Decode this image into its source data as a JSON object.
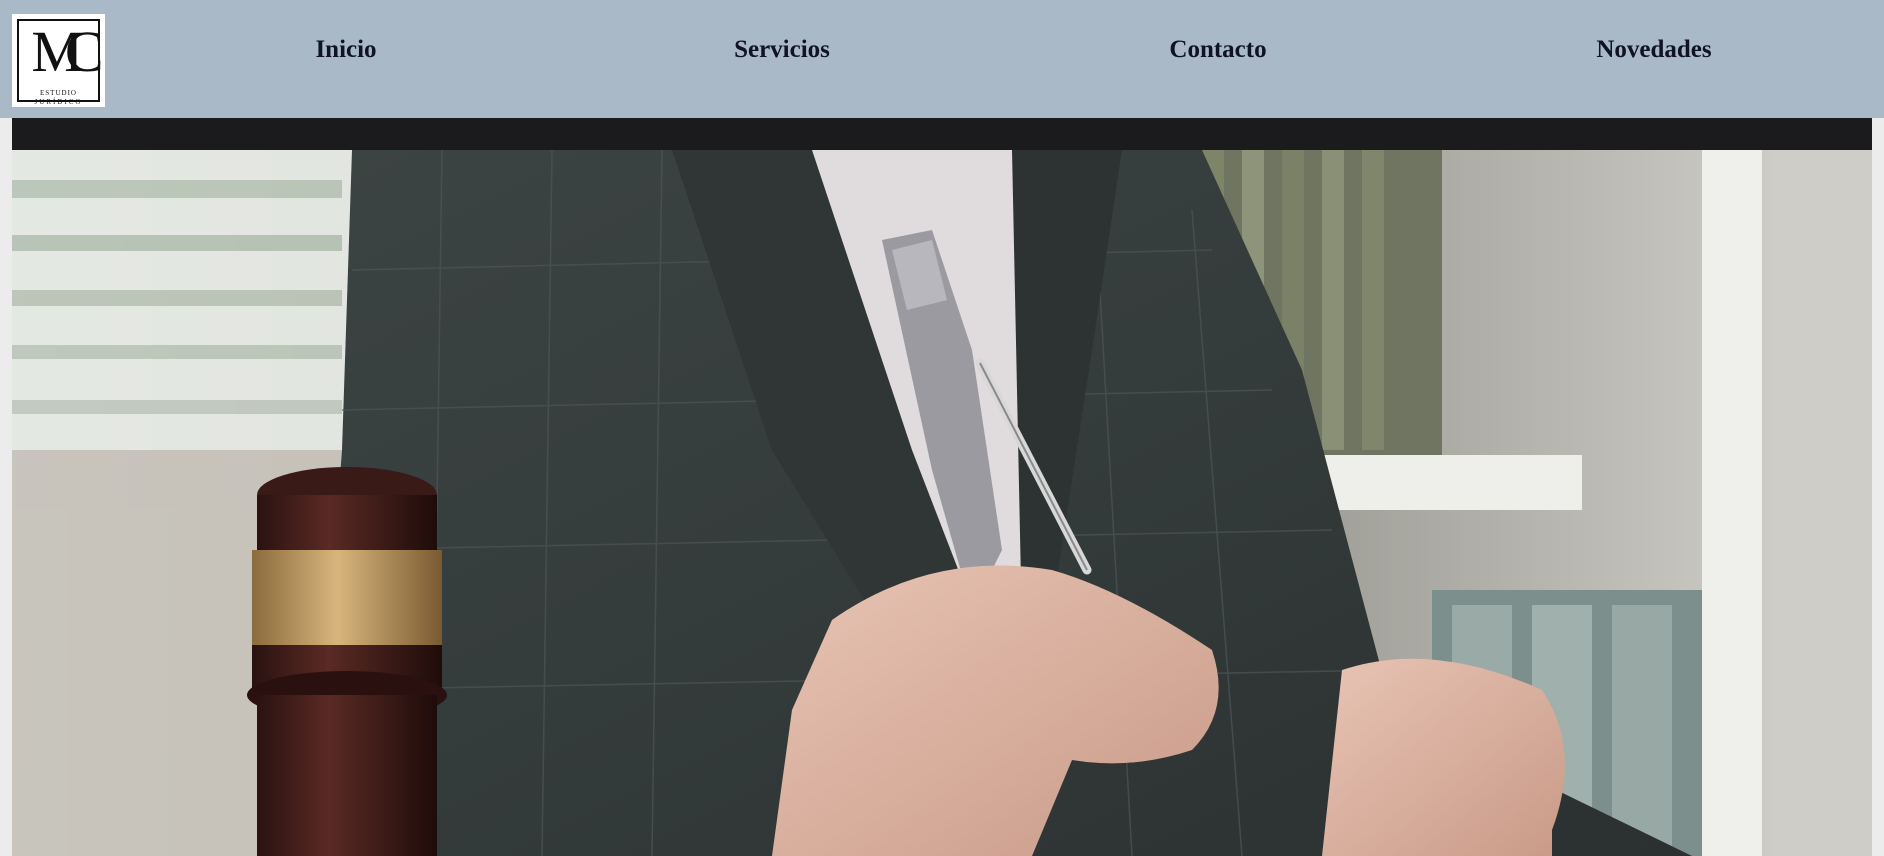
{
  "logo": {
    "mark": "MC",
    "line1": "ESTUDIO",
    "line2": "JURÍDICO"
  },
  "nav": {
    "items": [
      {
        "label": "Inicio"
      },
      {
        "label": "Servicios"
      },
      {
        "label": "Contacto"
      },
      {
        "label": "Novedades"
      }
    ]
  },
  "colors": {
    "header_bg": "#aab9c8",
    "nav_text": "#0f1322",
    "dark_bar": "#1b1b1e",
    "page_bg": "#ececec"
  },
  "hero": {
    "image": "lawyer-signing-document-with-gavel"
  }
}
